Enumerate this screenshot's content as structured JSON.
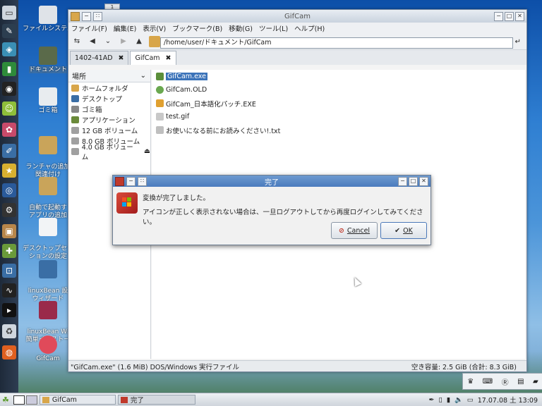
{
  "dock": {
    "icons": [
      "desktop-icon",
      "pen-icon",
      "app-icon",
      "notebook-icon",
      "camera-icon",
      "android-icon",
      "paint-icon",
      "edit-icon",
      "star-icon",
      "wifi-icon",
      "gear-icon",
      "box-icon",
      "add-icon",
      "projector-icon",
      "monitor-icon",
      "terminal-icon",
      "trash-icon",
      "firefox-icon"
    ]
  },
  "desktop": {
    "icons": [
      {
        "label": "ファイルシステム"
      },
      {
        "label": "ドキュメント"
      },
      {
        "label": "ゴミ箱"
      },
      {
        "label": "ランチャの追加\n関連付け"
      },
      {
        "label": "自動で起動す\nアプリの追加"
      },
      {
        "label": "デスクトップセッ\nションの設定"
      },
      {
        "label": "linuxBean 設\nウィザード"
      },
      {
        "label": "linuxBean Wi\n簡単インストー"
      },
      {
        "label": "GifCam"
      }
    ],
    "workspace_badge": "1"
  },
  "filemanager": {
    "title": "GifCam",
    "menu": [
      "ファイル(F)",
      "編集(E)",
      "表示(V)",
      "ブックマーク(B)",
      "移動(G)",
      "ツール(L)",
      "ヘルプ(H)"
    ],
    "path": "/home/user/ドキュメント/GifCam",
    "tabs": [
      {
        "label": "1402-41AD"
      },
      {
        "label": "GifCam"
      }
    ],
    "side_header": "場所",
    "places": [
      {
        "label": "ホームフォルダ",
        "color": "#d8a64a"
      },
      {
        "label": "デスクトップ",
        "color": "#3a6ea5"
      },
      {
        "label": "ゴミ箱",
        "color": "#888888"
      },
      {
        "label": "アプリケーション",
        "color": "#6a8a3a"
      },
      {
        "label": "12 GB ボリューム",
        "color": "#a0a0a0"
      },
      {
        "label": "8.0 GB ボリューム",
        "color": "#a0a0a0"
      },
      {
        "label": "4.0 GB ボリューム",
        "color": "#a0a0a0"
      }
    ],
    "files": [
      {
        "label": "GifCam.exe",
        "selected": true,
        "color": "#5b8f3a"
      },
      {
        "label": "GifCam.OLD",
        "selected": false,
        "color": "#6aa84f"
      },
      {
        "label": "GifCam_日本語化パッチ.EXE",
        "selected": false,
        "color": "#e0a030"
      },
      {
        "label": "test.gif",
        "selected": false,
        "color": "#c8c8c8"
      },
      {
        "label": "お使いになる前にお読みください!.txt",
        "selected": false,
        "color": "#bfbfbf"
      }
    ],
    "status_left": "\"GifCam.exe\" (1.6 MiB) DOS/Windows 実行ファイル",
    "status_right": "空き容量: 2.5 GiB (合計: 8.3 GiB)"
  },
  "dialog": {
    "title": "完了",
    "message1": "変換が完了しました。",
    "message2": "アイコンが正しく表示されない場合は、一旦ログアウトしてから再度ログインしてみてください。",
    "cancel_label": "Cancel",
    "ok_label": "OK"
  },
  "taskbar": {
    "tasks": [
      {
        "label": "GifCam"
      },
      {
        "label": "完了"
      }
    ],
    "clock": "17.07.08 土 13:09"
  },
  "colors": {
    "accent": "#3b73b9",
    "dialog_title": "#5f8cc9"
  }
}
